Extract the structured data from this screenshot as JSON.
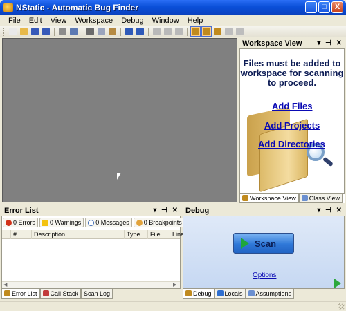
{
  "window": {
    "title": "NStatic - Automatic Bug Finder",
    "minimize": "_",
    "maximize": "□",
    "close": "X"
  },
  "menu": [
    "File",
    "Edit",
    "View",
    "Workspace",
    "Debug",
    "Window",
    "Help"
  ],
  "toolbar": {
    "buttons": [
      {
        "icon": "new-file-icon",
        "color": "#e9e9e9"
      },
      {
        "icon": "open-folder-icon",
        "color": "#e7b94a"
      },
      {
        "icon": "save-icon",
        "color": "#3659b8"
      },
      {
        "icon": "save-all-icon",
        "color": "#3659b8"
      },
      {
        "icon": "print-icon",
        "color": "#8c8c8c"
      },
      {
        "icon": "find-icon",
        "color": "#5d7ab3"
      },
      {
        "icon": "cut-icon",
        "color": "#6b6b6b"
      },
      {
        "icon": "copy-icon",
        "color": "#9aa4bd"
      },
      {
        "icon": "paste-icon",
        "color": "#b58a43"
      },
      {
        "icon": "undo-icon",
        "color": "#2e59b8"
      },
      {
        "icon": "redo-icon",
        "color": "#2e59b8"
      },
      {
        "icon": "play-icon",
        "color": "#b9b9b9"
      },
      {
        "icon": "step-icon",
        "color": "#b9b9b9"
      },
      {
        "icon": "stop-icon",
        "color": "#b9b9b9"
      },
      {
        "icon": "scan-workspace-icon",
        "color": "#c08a1e"
      },
      {
        "icon": "scan-file-icon",
        "color": "#c08a1e"
      },
      {
        "icon": "bug-icon",
        "color": "#c08a1e"
      },
      {
        "icon": "bug-disabled-icon",
        "color": "#bdbdbd"
      },
      {
        "icon": "bug-settings-icon",
        "color": "#bdbdbd"
      }
    ]
  },
  "workspace_view": {
    "title": "Workspace View",
    "message": "Files must be added to workspace for scanning to proceed.",
    "links": {
      "add_files": "Add Files",
      "add_projects": "Add Projects",
      "add_directories": "Add Directories"
    },
    "tabs": [
      "Workspace View",
      "Class View"
    ]
  },
  "error_list": {
    "title": "Error List",
    "filters": {
      "errors": "0 Errors",
      "warnings": "0 Warnings",
      "messages": "0 Messages",
      "breakpoints": "0 Breakpoints"
    },
    "columns": [
      "#",
      "Description",
      "Type",
      "File",
      "Line"
    ],
    "tabs": [
      "Error List",
      "Call Stack",
      "Scan Log"
    ]
  },
  "debug": {
    "title": "Debug",
    "scan_label": "Scan",
    "options_label": "Options",
    "tabs": [
      "Debug",
      "Locals",
      "Assumptions"
    ]
  },
  "panel_controls": "▾ ⊣ ✕",
  "colors": {
    "title_bar": "#0a4fd8",
    "editor_bg": "#808080",
    "link": "#0a0ab4",
    "scan_button": "#2f78d8"
  }
}
